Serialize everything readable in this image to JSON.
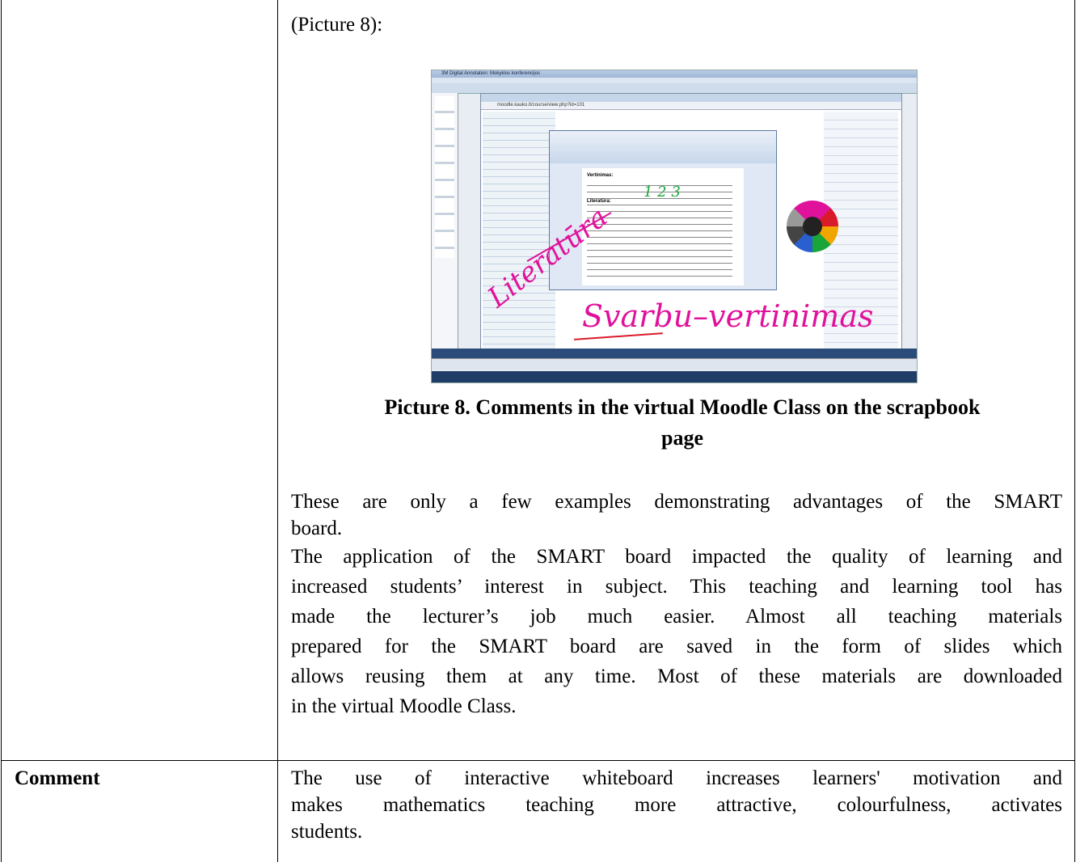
{
  "intro_label": "(Picture 8):",
  "caption_line1": "Picture 8. Comments in the virtual Moodle Class on the scrapbook",
  "caption_line2": "page",
  "para1_line1": "These are only a few examples demonstrating advantages of the SMART",
  "para1_line2": "board.",
  "para2_lines": [
    "The application of the SMART board impacted the quality of learning and",
    "increased students’ interest in subject. This teaching and learning tool has",
    "made the lecturer’s job much easier. Almost all teaching materials",
    "prepared for the SMART board are saved in the form of slides which",
    "allows reusing them at any time. Most of these materials are downloaded",
    "in the virtual Moodle Class."
  ],
  "comment_label": "Comment",
  "comment_lines": [
    "The use of interactive whiteboard increases learners' motivation and",
    "makes mathematics teaching more attractive, colourfulness, activates",
    "students."
  ],
  "screenshot": {
    "app_title": "3M Digital Annotation: Mokyklos konferencijos",
    "url": "moodle.kauko.lt/course/view.php?id=101",
    "ink_literatura": "Literatūra",
    "ink_svarbu": "Svarbu–vertinimas",
    "ink_numbers": "1   2   3",
    "doc_heading": "Vertinimas:",
    "doc_literatura": "Literatūra:",
    "colors": {
      "ink_pink": "#e0129c",
      "ink_red": "#d91a2a",
      "ink_green": "#1aa53a",
      "taskbar": "#1f3d66"
    }
  }
}
